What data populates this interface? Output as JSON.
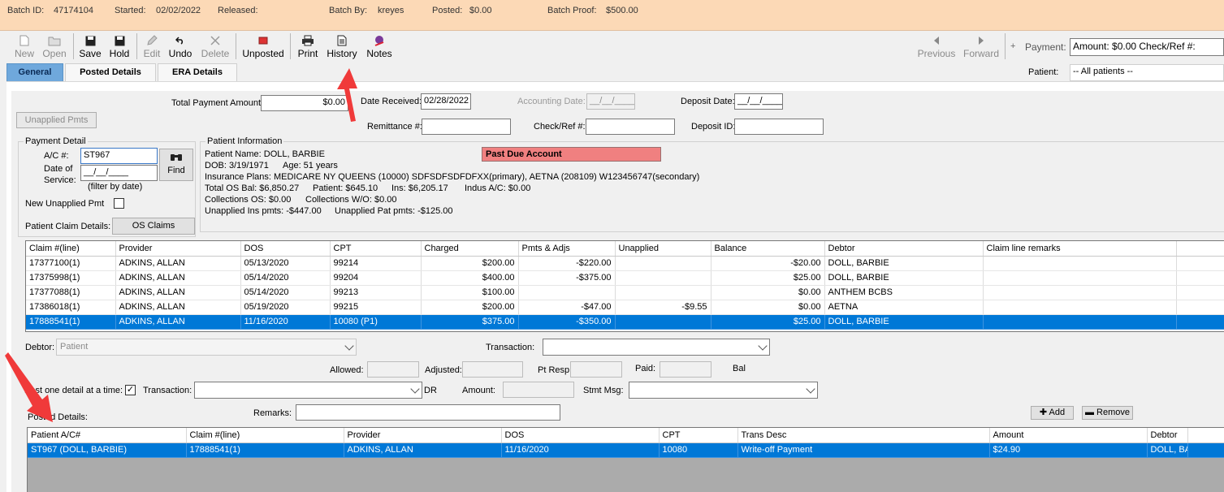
{
  "batch": {
    "batch_id_label": "Batch ID:",
    "batch_id": "47174104",
    "started_label": "Started:",
    "started": "02/02/2022",
    "released_label": "Released:",
    "released": "",
    "batch_by_label": "Batch By:",
    "batch_by": "kreyes",
    "posted_label": "Posted:",
    "posted": "$0.00",
    "batch_proof_label": "Batch Proof:",
    "batch_proof": "$500.00"
  },
  "toolbar": {
    "new": "New",
    "open": "Open",
    "save": "Save",
    "hold": "Hold",
    "edit": "Edit",
    "undo": "Undo",
    "delete": "Delete",
    "unposted": "Unposted",
    "print": "Print",
    "history": "History",
    "notes": "Notes",
    "previous": "Previous",
    "forward": "Forward",
    "plus": "+",
    "payment_label": "Payment:",
    "payment_value": "Amount: $0.00 Check/Ref #:",
    "patient_label": "Patient:",
    "patient_value": "-- All patients --"
  },
  "tabs": [
    {
      "label": "General"
    },
    {
      "label": "Posted Details"
    },
    {
      "label": "ERA Details"
    }
  ],
  "header": {
    "total_payment_label": "Total Payment Amount:",
    "total_payment": "$0.00",
    "date_received_label": "Date Received:",
    "date_received": "02/28/2022",
    "accounting_date_label": "Accounting Date:",
    "accounting_date": "__/__/____",
    "deposit_date_label": "Deposit Date:",
    "deposit_date": "__/__/____",
    "remittance_label": "Remittance #:",
    "remittance": "",
    "checkref_label": "Check/Ref #:",
    "checkref": "",
    "deposit_id_label": "Deposit ID:",
    "deposit_id": "",
    "unapplied_btn": "Unapplied Pmts"
  },
  "payment_detail": {
    "title": "Payment Detail",
    "ac_label": "A/C #:",
    "ac": "ST967",
    "dos_label1": "Date of",
    "dos_label2": "Service:",
    "dos": "__/__/____",
    "find": "Find",
    "filter_note": "(filter by date)",
    "new_unapplied": "New Unapplied Pmt",
    "claim_details_label": "Patient Claim Details:",
    "os_claims": "OS Claims"
  },
  "patient_info": {
    "title": "Patient Information",
    "name": "Patient Name:  DOLL, BARBIE",
    "dob": "DOB: 3/19/1971",
    "age": "Age: 51 years",
    "plans": "Insurance Plans:  MEDICARE NY QUEENS (10000) SDFSDFSDFDFXX(primary), AETNA (208109) W123456747(secondary)",
    "total_os": "Total OS Bal:  $6,850.27",
    "patient_bal": "Patient:  $645.10",
    "ins_bal": "Ins:  $6,205.17",
    "indus": "Indus A/C:  $0.00",
    "collections_os": "Collections OS:  $0.00",
    "collections_wo": "Collections W/O:  $0.00",
    "unapplied_ins": "Unapplied Ins pmts:  -$447.00",
    "unapplied_pat": "Unapplied Pat pmts:  -$125.00",
    "alert": "Past Due Account",
    "alert_color": "#f08080"
  },
  "claims": {
    "columns": [
      "Claim #(line)",
      "Provider",
      "DOS",
      "CPT",
      "Charged",
      "Pmts & Adjs",
      "Unapplied",
      "Balance",
      "Debtor",
      "Claim line remarks"
    ],
    "rows": [
      [
        "17377100(1)",
        "ADKINS, ALLAN",
        "05/13/2020",
        "99214",
        "$200.00",
        "-$220.00",
        "",
        "-$20.00",
        "DOLL, BARBIE",
        ""
      ],
      [
        "17375998(1)",
        "ADKINS, ALLAN",
        "05/14/2020",
        "99204",
        "$400.00",
        "-$375.00",
        "",
        "$25.00",
        "DOLL, BARBIE",
        ""
      ],
      [
        "17377088(1)",
        "ADKINS, ALLAN",
        "05/14/2020",
        "99213",
        "$100.00",
        "",
        "",
        "$0.00",
        "ANTHEM BCBS",
        ""
      ],
      [
        "17386018(1)",
        "ADKINS, ALLAN",
        "05/19/2020",
        "99215",
        "$200.00",
        "-$47.00",
        "-$9.55",
        "$0.00",
        "AETNA",
        ""
      ],
      [
        "17888541(1)",
        "ADKINS, ALLAN",
        "11/16/2020",
        "10080 (P1)",
        "$375.00",
        "-$350.00",
        "",
        "$25.00",
        "DOLL, BARBIE",
        ""
      ]
    ],
    "selected_index": 4
  },
  "detail": {
    "debtor_label": "Debtor:",
    "debtor": "Patient",
    "transaction_label": "Transaction:",
    "transaction": "",
    "allowed_label": "Allowed:",
    "adjusted_label": "Adjusted:",
    "ptresp_label": "Pt Resp:",
    "paid_label": "Paid:",
    "bal_label": "Bal",
    "post_one_label": "Post one detail at a time:",
    "transaction2_label": "Transaction:",
    "transaction2": "",
    "dr_label": "DR",
    "amount_label": "Amount:",
    "stmt_label": "Stmt Msg:",
    "stmt": "",
    "remarks_label": "Remarks:",
    "remarks": "",
    "posted_details_label": "Posted Details:",
    "add": "Add",
    "remove": "Remove"
  },
  "posted": {
    "columns": [
      "Patient A/C#",
      "Claim #(line)",
      "Provider",
      "DOS",
      "CPT",
      "Trans Desc",
      "Amount",
      "Debtor"
    ],
    "rows": [
      [
        "ST967 (DOLL, BARBIE)",
        "17888541(1)",
        "ADKINS, ALLAN",
        "11/16/2020",
        "10080",
        "Write-off Payment",
        "$24.90",
        "DOLL, BARBIE"
      ]
    ]
  },
  "colors": {
    "batch_bg": "#fcd9b6",
    "selection": "#0078d7",
    "tab_active": "#6fa8dc",
    "annotation_arrow": "#f03a3a"
  }
}
